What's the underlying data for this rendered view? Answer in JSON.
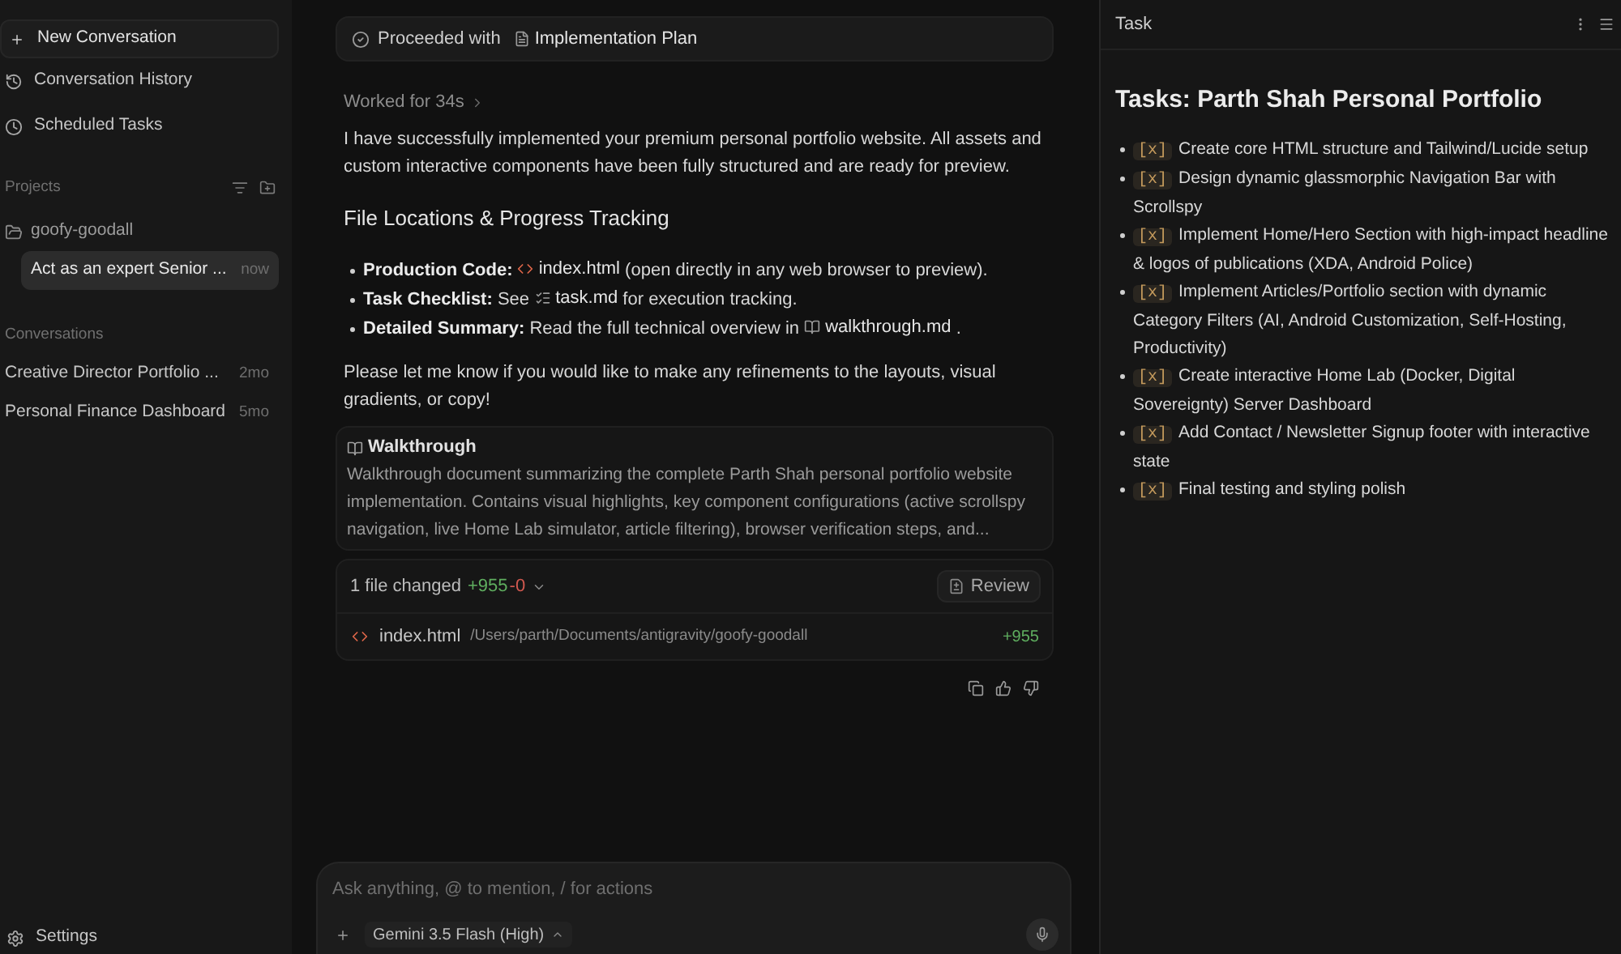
{
  "sidebar": {
    "new_button": "New Conversation",
    "nav": [
      {
        "kind": "history",
        "label": "Conversation History"
      },
      {
        "kind": "scheduled",
        "label": "Scheduled Tasks"
      }
    ],
    "projects": {
      "title": "Projects",
      "items": [
        {
          "name": "goofy-goodall",
          "expanded": true,
          "children": [
            {
              "title": "Act as an expert Senior ...",
              "time": "now",
              "selected": true
            }
          ]
        }
      ]
    },
    "conversations": {
      "title": "Conversations",
      "items": [
        {
          "title": "Creative Director Portfolio ...",
          "time": "2mo",
          "selected": false
        },
        {
          "title": "Personal Finance Dashboard",
          "time": "5mo",
          "selected": false
        }
      ]
    },
    "settings": "Settings"
  },
  "chat": {
    "banner": {
      "label": "Proceeded with",
      "file": {
        "kind": "document",
        "name": "Implementation Plan"
      }
    },
    "worked": {
      "label": "Worked for 34s",
      "expanded": false
    },
    "intro": "I have successfully implemented your premium personal portfolio website. All assets and custom interactive components have been fully structured and are ready for preview.",
    "heading": "File Locations & Progress Tracking",
    "bullets": [
      {
        "label": "Production Code:",
        "file": {
          "kind": "code",
          "name": "index.html"
        },
        "after": "(open directly in any web browser to preview)."
      },
      {
        "label": "Task Checklist:",
        "before": "See",
        "file": {
          "kind": "list",
          "name": "task.md"
        },
        "after": "for execution tracking."
      },
      {
        "label": "Detailed Summary:",
        "before": "Read the full technical overview in",
        "file": {
          "kind": "book",
          "name": "walkthrough.md"
        },
        "after": "."
      }
    ],
    "closing": "Please let me know if you would like to make any refinements to the layouts, visual gradients, or copy!",
    "artifact": {
      "title": "Walkthrough",
      "description": "Walkthrough document summarizing the complete Parth Shah personal portfolio website implementation. Contains visual highlights, key component configurations (active scrollspy navigation, live Home Lab simulator, article filtering), browser verification steps, and..."
    },
    "changes": {
      "summary": "1 file changed",
      "added": "+955",
      "removed": "-0",
      "expanded": true,
      "review": "Review",
      "files": [
        {
          "kind": "code",
          "name": "index.html",
          "path": "/Users/parth/Documents/antigravity/goofy-goodall",
          "added": "+955"
        }
      ]
    },
    "composer": {
      "placeholder": "Ask anything, @ to mention, / for actions",
      "model": "Gemini 3.5 Flash (High)"
    }
  },
  "task_panel": {
    "title": "Task",
    "heading": "Tasks: Parth Shah Personal Portfolio",
    "items": [
      {
        "marker": "[x]",
        "text": "Create core HTML structure and Tailwind/Lucide setup"
      },
      {
        "marker": "[x]",
        "text": "Design dynamic glassmorphic Navigation Bar with Scrollspy"
      },
      {
        "marker": "[x]",
        "text": "Implement Home/Hero Section with high-impact headline & logos of publications (XDA, Android Police)"
      },
      {
        "marker": "[x]",
        "text": "Implement Articles/Portfolio section with dynamic Category Filters (AI, Android Customization, Self-Hosting, Productivity)"
      },
      {
        "marker": "[x]",
        "text": "Create interactive Home Lab (Docker, Digital Sovereignty) Server Dashboard"
      },
      {
        "marker": "[x]",
        "text": "Add Contact / Newsletter Signup footer with interactive state"
      },
      {
        "marker": "[x]",
        "text": "Final testing and styling polish"
      }
    ]
  }
}
